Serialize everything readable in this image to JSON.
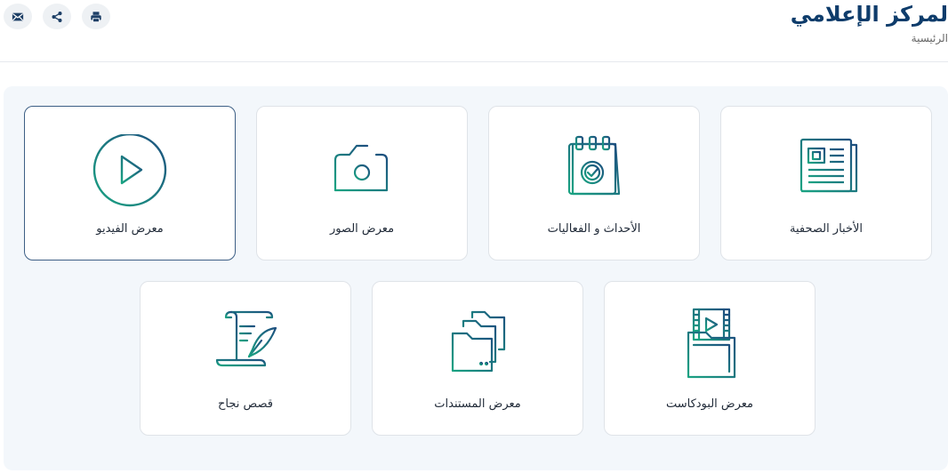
{
  "header": {
    "title": "لمركز الإعلامي",
    "breadcrumb": "الرئيسية"
  },
  "actions": [
    {
      "name": "print",
      "icon": "print-icon"
    },
    {
      "name": "share",
      "icon": "share-icon"
    },
    {
      "name": "email",
      "icon": "mail-icon"
    }
  ],
  "colors": {
    "title": "#0e3c6b",
    "icon_gradient_start": "#1aa382",
    "icon_gradient_end": "#1d4f7f",
    "panel_bg": "#f3f7fb",
    "active_border": "#3d5f85"
  },
  "cards": [
    {
      "label": "الأخبار الصحفية",
      "icon": "newspaper-icon"
    },
    {
      "label": "الأحداث و الفعاليات",
      "icon": "calendar-check-icon"
    },
    {
      "label": "معرض الصور",
      "icon": "camera-icon"
    },
    {
      "label": "معرض الفيديو",
      "icon": "play-circle-icon",
      "active": true
    },
    {
      "label": "معرض البودكاست",
      "icon": "video-folder-icon"
    },
    {
      "label": "معرض المستندات",
      "icon": "folders-icon"
    },
    {
      "label": "قصص نجاح",
      "icon": "scroll-quill-icon"
    }
  ]
}
